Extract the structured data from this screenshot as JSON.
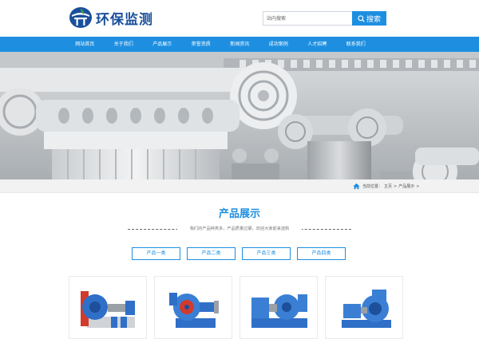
{
  "header": {
    "logo_text": "环保监测",
    "search_placeholder": "站内搜索",
    "search_button": "搜索"
  },
  "nav": {
    "items": [
      "网站首页",
      "关于我们",
      "产品展示",
      "荣誉资质",
      "新闻资讯",
      "成功案例",
      "人才招聘",
      "联系我们"
    ]
  },
  "breadcrumb": {
    "prefix": "当前位置：",
    "home": "主页",
    "sep": ">",
    "current": "产品展示",
    "tail": ">"
  },
  "section": {
    "title": "产品展示",
    "subtitle": "我们的产品种类多，产品质量过硬，欢迎大家前来选购"
  },
  "categories": [
    "产品一类",
    "产品二类",
    "产品三类",
    "产品四类"
  ],
  "colors": {
    "brand_blue": "#1e8fe0",
    "logo_navy": "#1a4f9c",
    "logo_green": "#3aa23a"
  },
  "icons": {
    "search": "search-icon",
    "home": "home-icon"
  }
}
